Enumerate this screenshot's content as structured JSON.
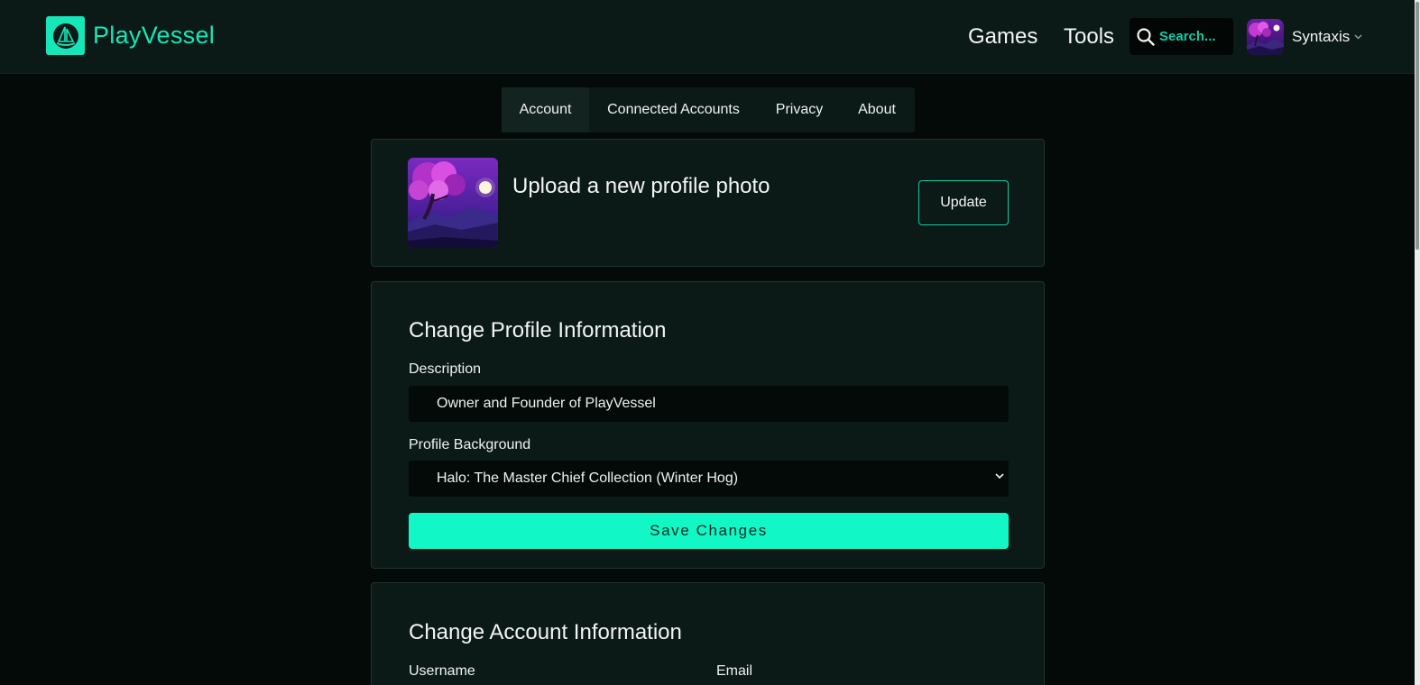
{
  "header": {
    "brand": "PlayVessel",
    "nav": [
      "Games",
      "Tools"
    ],
    "search_placeholder": "Search...",
    "user_name": "Syntaxis"
  },
  "tabs": [
    "Account",
    "Connected Accounts",
    "Privacy",
    "About"
  ],
  "active_tab": "Account",
  "photo_card": {
    "title": "Upload a new profile photo",
    "button": "Update"
  },
  "profile_card": {
    "title": "Change Profile Information",
    "description_label": "Description",
    "description_value": "Owner and Founder of PlayVessel",
    "background_label": "Profile Background",
    "background_value": "Halo: The Master Chief Collection (Winter Hog)",
    "save_button": "Save Changes"
  },
  "account_card": {
    "title": "Change Account Information",
    "username_label": "Username",
    "email_label": "Email"
  },
  "colors": {
    "accent": "#16e6b8",
    "save_button": "#12f7c6",
    "page_bg": "#030a08",
    "panel_bg": "#0c1a17"
  }
}
